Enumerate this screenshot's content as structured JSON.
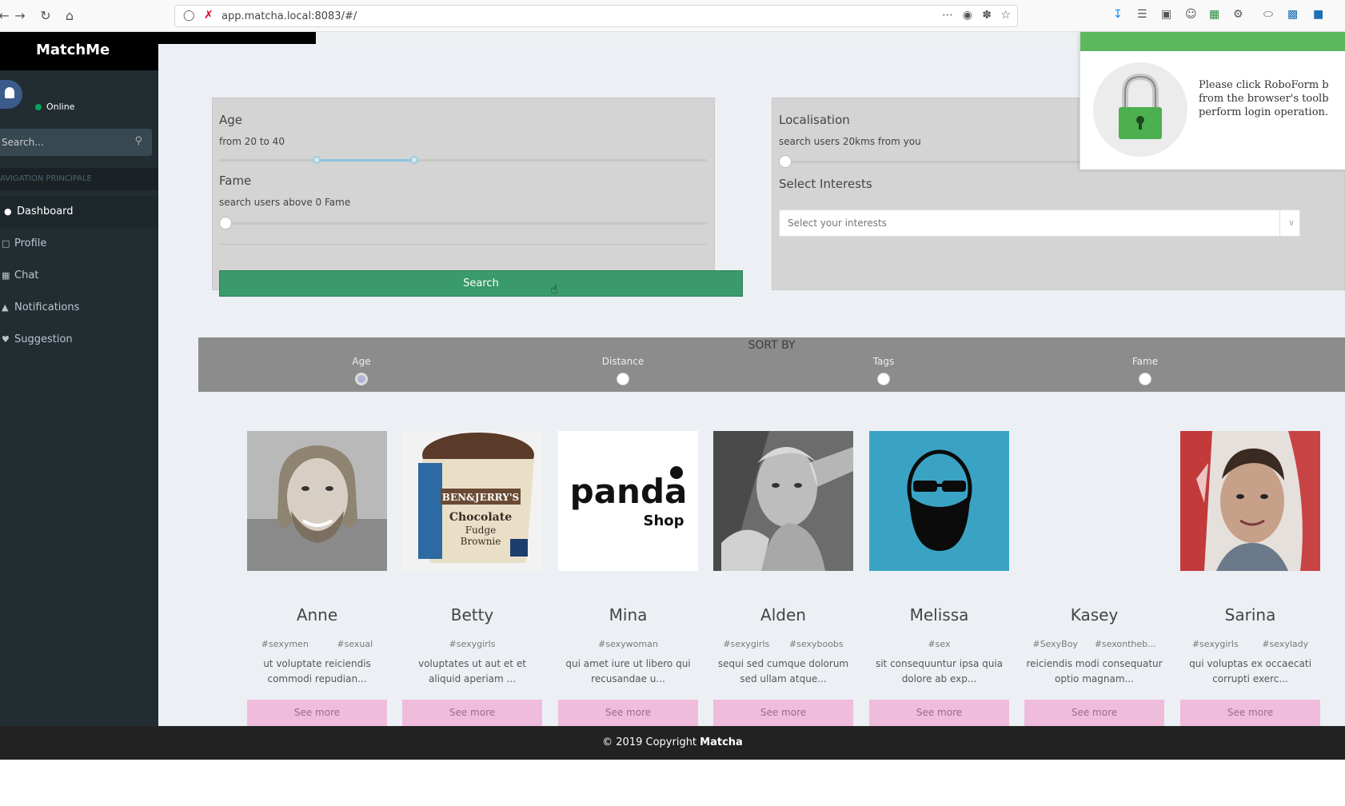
{
  "browser": {
    "url": "app.matcha.local:8083/#/",
    "more_label": "⋯"
  },
  "app": {
    "brand": "MatchMe",
    "hamburger": "≡"
  },
  "sidebar": {
    "status": "Online",
    "search_placeholder": "Search...",
    "section_header": "AVIGATION PRINCIPALE",
    "items": [
      {
        "label": "Dashboard",
        "icon": "dashboard-icon"
      },
      {
        "label": "Profile",
        "icon": "profile-icon"
      },
      {
        "label": "Chat",
        "icon": "chat-icon"
      },
      {
        "label": "Notifications",
        "icon": "bell-icon"
      },
      {
        "label": "Suggestion",
        "icon": "suggestion-icon"
      }
    ]
  },
  "filters": {
    "age": {
      "title": "Age",
      "subtitle": "from 20 to 40",
      "min": 20,
      "max": 40
    },
    "fame": {
      "title": "Fame",
      "subtitle": "search users above 0 Fame",
      "value": 0
    },
    "search_button": "Search",
    "localisation": {
      "title": "Localisation",
      "subtitle": "search users 20kms from you",
      "value": 20
    },
    "interests": {
      "title": "Select Interests",
      "placeholder": "Select your interests"
    }
  },
  "sort": {
    "title": "SORT BY",
    "options": [
      "Age",
      "Distance",
      "Tags",
      "Fame"
    ],
    "selected": "Age"
  },
  "profiles": [
    {
      "name": "Anne",
      "tags": [
        "#sexymen",
        "#sexual"
      ],
      "desc_line1": "ut voluptate reiciendis",
      "desc_line2": "commodi repudian...",
      "see_more": "See more"
    },
    {
      "name": "Betty",
      "tags": [
        "#sexygirls"
      ],
      "desc_line1": "voluptates ut aut et et",
      "desc_line2": "aliquid aperiam ...",
      "see_more": "See more"
    },
    {
      "name": "Mina",
      "tags": [
        "#sexywoman"
      ],
      "desc_line1": "qui amet iure ut libero qui",
      "desc_line2": "recusandae u...",
      "see_more": "See more"
    },
    {
      "name": "Alden",
      "tags": [
        "#sexygirls",
        "#sexyboobs"
      ],
      "desc_line1": "sequi sed cumque dolorum",
      "desc_line2": "sed ullam atque...",
      "see_more": "See more"
    },
    {
      "name": "Melissa",
      "tags": [
        "#sex"
      ],
      "desc_line1": "sit consequuntur ipsa quia",
      "desc_line2": "dolore ab exp...",
      "see_more": "See more"
    },
    {
      "name": "Kasey",
      "tags": [
        "#SexyBoy",
        "#sexontheb..."
      ],
      "desc_line1": "reiciendis modi consequatur",
      "desc_line2": "optio magnam...",
      "see_more": "See more"
    },
    {
      "name": "Sarina",
      "tags": [
        "#sexygirls",
        "#sexylady"
      ],
      "desc_line1": "qui voluptas ex occaecati",
      "desc_line2": "corrupti exerc...",
      "see_more": "See more"
    }
  ],
  "picture_text": {
    "betty_brand": "BEN&JERRY'S",
    "betty_flavor_1": "Chocolate",
    "betty_flavor_2": "Fudge",
    "betty_flavor_3": "Brownie",
    "mina_logo": "panda",
    "mina_shop": "Shop"
  },
  "footer": {
    "text": "© 2019 Copyright",
    "brand": "Matcha"
  },
  "roboform": {
    "line1": "Please click RoboForm b",
    "line2": "from the browser's toolb",
    "line3": "perform login operation."
  },
  "colors": {
    "sidebar": "#222d32",
    "search_button": "#3a9a6b",
    "see_more": "#f0bcdc",
    "sortbar": "#8c8c8c",
    "footer": "#222222"
  }
}
